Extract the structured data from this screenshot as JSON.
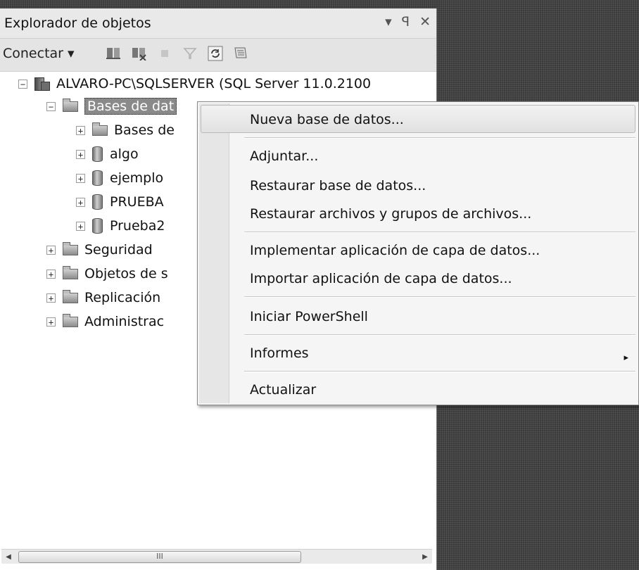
{
  "panel": {
    "title": "Explorador de objetos",
    "controls": {
      "dropdown": "▾",
      "pin": "ꟼ",
      "close": "✕"
    }
  },
  "toolbar": {
    "connect_label": "Conectar",
    "connect_arrow": "▾"
  },
  "tree": {
    "server": "ALVARO-PC\\SQLSERVER (SQL Server 11.0.2100",
    "databases_folder": "Bases de dat",
    "children": [
      "Bases de",
      "algo",
      "ejemplo",
      "PRUEBA",
      "Prueba2"
    ],
    "siblings": [
      "Seguridad",
      "Objetos de s",
      "Replicación",
      "Administrac"
    ]
  },
  "scrollbar": {
    "thumb_label": "III"
  },
  "context_menu": {
    "items": [
      "Nueva base de datos...",
      "Adjuntar...",
      "Restaurar base de datos...",
      "Restaurar archivos y grupos de archivos...",
      "Implementar aplicación de capa de datos...",
      "Importar aplicación de capa de datos...",
      "Iniciar PowerShell",
      "Informes",
      "Actualizar"
    ],
    "submenu_arrow": "▸"
  }
}
